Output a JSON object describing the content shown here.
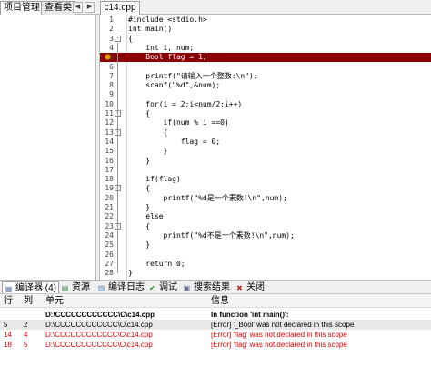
{
  "project_panel": {
    "tabs": [
      "项目管理",
      "查看类"
    ],
    "active_tab": "项目管理",
    "arrow_left": "◀",
    "arrow_right": "▶"
  },
  "editor": {
    "tab_label": "c14.cpp",
    "highlight_color": "#8b0000",
    "lines": [
      {
        "n": "1",
        "fold": "",
        "bp": false,
        "text": "#include <stdio.h>"
      },
      {
        "n": "2",
        "fold": "",
        "bp": false,
        "text": "int main()"
      },
      {
        "n": "3",
        "fold": "-",
        "bp": false,
        "text": "{"
      },
      {
        "n": "4",
        "fold": "",
        "bp": false,
        "text": "    int i, num;"
      },
      {
        "n": "5",
        "fold": "",
        "bp": true,
        "text": "    Bool flag = 1;"
      },
      {
        "n": "6",
        "fold": "",
        "bp": false,
        "text": ""
      },
      {
        "n": "7",
        "fold": "",
        "bp": false,
        "text": "    printf(\"请输入一个整数:\\n\");"
      },
      {
        "n": "8",
        "fold": "",
        "bp": false,
        "text": "    scanf(\"%d\",&num);"
      },
      {
        "n": "9",
        "fold": "",
        "bp": false,
        "text": ""
      },
      {
        "n": "10",
        "fold": "",
        "bp": false,
        "text": "    for(i = 2;i<num/2;i++)"
      },
      {
        "n": "11",
        "fold": "-",
        "bp": false,
        "text": "    {"
      },
      {
        "n": "12",
        "fold": "",
        "bp": false,
        "text": "        if(num % i ==0)"
      },
      {
        "n": "13",
        "fold": "-",
        "bp": false,
        "text": "        {"
      },
      {
        "n": "14",
        "fold": "",
        "bp": false,
        "text": "            flag = 0;"
      },
      {
        "n": "15",
        "fold": "",
        "bp": false,
        "text": "        }"
      },
      {
        "n": "16",
        "fold": "",
        "bp": false,
        "text": "    }"
      },
      {
        "n": "17",
        "fold": "",
        "bp": false,
        "text": ""
      },
      {
        "n": "18",
        "fold": "",
        "bp": false,
        "text": "    if(flag)"
      },
      {
        "n": "19",
        "fold": "-",
        "bp": false,
        "text": "    {"
      },
      {
        "n": "20",
        "fold": "",
        "bp": false,
        "text": "        printf(\"%d是一个素数!\\n\",num);"
      },
      {
        "n": "21",
        "fold": "",
        "bp": false,
        "text": "    }"
      },
      {
        "n": "22",
        "fold": "",
        "bp": false,
        "text": "    else"
      },
      {
        "n": "23",
        "fold": "-",
        "bp": false,
        "text": "    {"
      },
      {
        "n": "24",
        "fold": "",
        "bp": false,
        "text": "        printf(\"%d不是一个素数!\\n\",num);"
      },
      {
        "n": "25",
        "fold": "",
        "bp": false,
        "text": "    }"
      },
      {
        "n": "26",
        "fold": "",
        "bp": false,
        "text": ""
      },
      {
        "n": "27",
        "fold": "",
        "bp": false,
        "text": "    return 0;"
      },
      {
        "n": "28",
        "fold": "",
        "bp": false,
        "text": "}"
      }
    ]
  },
  "bottom_tabs": [
    {
      "label": "编译器 (4)",
      "icon": "compiler-icon",
      "glyph": "▦",
      "color": "#5a7fb0"
    },
    {
      "label": "资源",
      "icon": "resources-icon",
      "glyph": "▤",
      "color": "#3c8a3c"
    },
    {
      "label": "编译日志",
      "icon": "compile-log-icon",
      "glyph": "▥",
      "color": "#4a7ab0"
    },
    {
      "label": "调试",
      "icon": "debug-icon",
      "glyph": "✔",
      "color": "#2a8a2a"
    },
    {
      "label": "搜索结果",
      "icon": "search-results-icon",
      "glyph": "▣",
      "color": "#6a6a9a"
    },
    {
      "label": "关闭",
      "icon": "close-icon",
      "glyph": "✖",
      "color": "#c03030"
    }
  ],
  "results": {
    "headers": {
      "row": "行",
      "col": "列",
      "unit": "单元",
      "info": "信息"
    },
    "rows": [
      {
        "row": "",
        "col": "",
        "unit": "D:\\CCCCCCCCCCCC\\C\\c14.cpp",
        "info": "In function 'int main()':",
        "style": "bold"
      },
      {
        "row": "5",
        "col": "2",
        "unit": "D:\\CCCCCCCCCCCC\\C\\c14.cpp",
        "info": "[Error] '_Bool' was not declared in this scope",
        "style": "sel"
      },
      {
        "row": "14",
        "col": "4",
        "unit": "D:\\CCCCCCCCCCCC\\C\\c14.cpp",
        "info": "[Error] 'flag' was not declared in this scope",
        "style": "err"
      },
      {
        "row": "18",
        "col": "5",
        "unit": "D:\\CCCCCCCCCCCC\\C\\c14.cpp",
        "info": "[Error] 'flag' was not declared in this scope",
        "style": "err"
      }
    ]
  }
}
